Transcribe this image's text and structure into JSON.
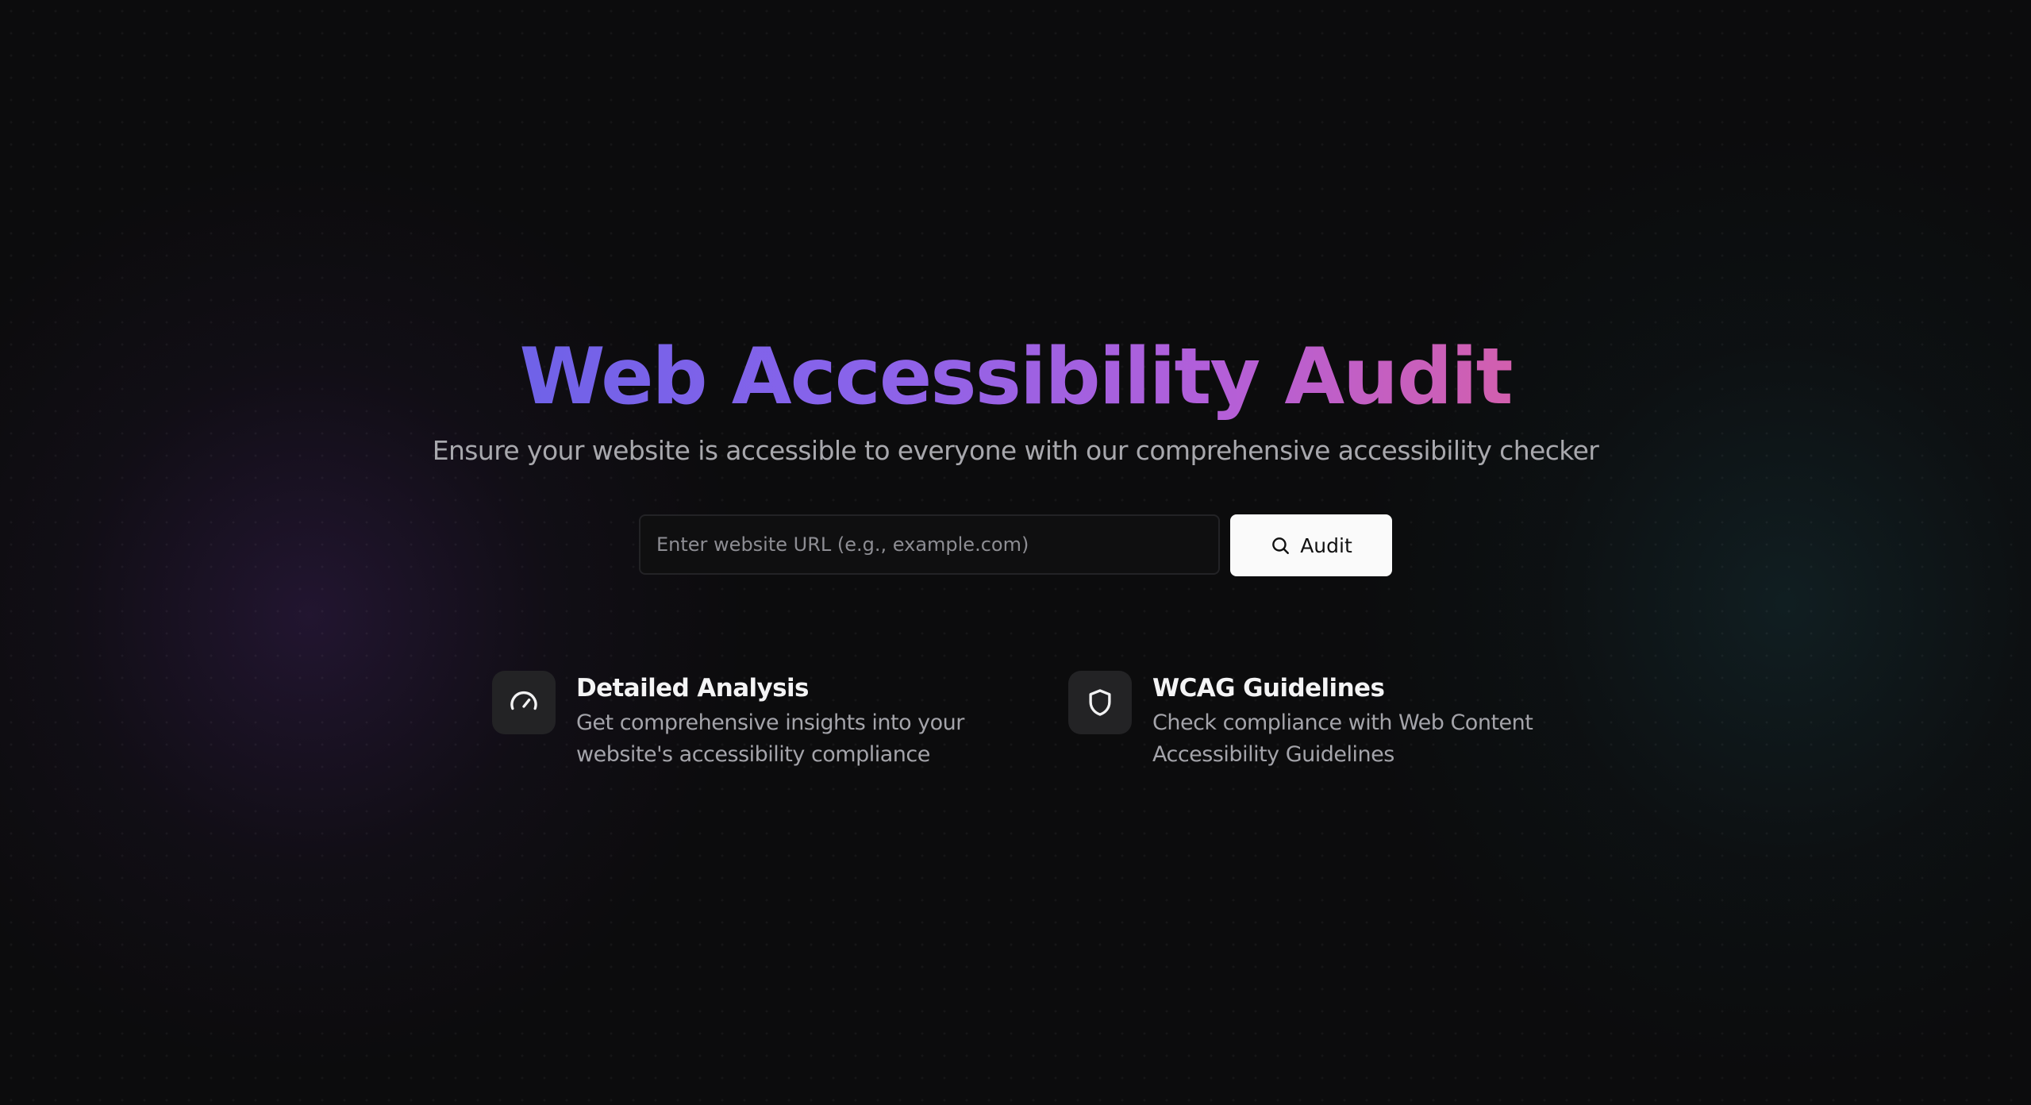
{
  "hero": {
    "title": "Web Accessibility Audit",
    "subtitle": "Ensure your website is accessible to everyone with our comprehensive accessibility checker"
  },
  "search": {
    "placeholder": "Enter website URL (e.g., example.com)",
    "value": "",
    "button_label": "Audit",
    "button_icon": "search-icon"
  },
  "features": [
    {
      "icon": "gauge-icon",
      "title": "Detailed Analysis",
      "description_line1": "Get comprehensive insights into your",
      "description_line2": "website's accessibility compliance"
    },
    {
      "icon": "shield-icon",
      "title": "WCAG Guidelines",
      "description_line1": "Check compliance with Web Content",
      "description_line2": "Accessibility Guidelines"
    }
  ],
  "colors": {
    "background": "#0c0c0d",
    "title_gradient_start": "#6f62e8",
    "title_gradient_end": "#d25fae",
    "button_background": "#fafafa"
  }
}
